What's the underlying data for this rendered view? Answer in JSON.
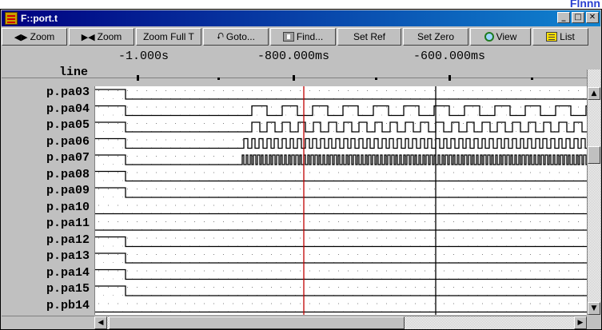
{
  "corner_text": "Flnnn",
  "window": {
    "title": "F::port.t"
  },
  "window_buttons": {
    "minimize": "_",
    "maximize": "□",
    "close": "✕"
  },
  "toolbar": [
    {
      "label": "Zoom",
      "icon": "◀▶",
      "icon_name": "zoom-out-icon"
    },
    {
      "label": "Zoom",
      "icon": "▶◀",
      "icon_name": "zoom-in-icon"
    },
    {
      "label": "Zoom Full T",
      "icon": "",
      "icon_name": ""
    },
    {
      "label": "Goto...",
      "icon": "⮏",
      "icon_name": "goto-icon"
    },
    {
      "label": "Find...",
      "icon": "find",
      "icon_name": "binoculars-icon"
    },
    {
      "label": "Set Ref",
      "icon": "",
      "icon_name": ""
    },
    {
      "label": "Set Zero",
      "icon": "",
      "icon_name": ""
    },
    {
      "label": "View",
      "icon": "view",
      "icon_name": "magnifier-icon"
    },
    {
      "label": "List",
      "icon": "list",
      "icon_name": "list-icon"
    }
  ],
  "timeline": {
    "labels": [
      "-1.000s",
      "-800.000ms",
      "-600.000ms"
    ],
    "line_header": "line"
  },
  "signals": [
    "p.pa03",
    "p.pa04",
    "p.pa05",
    "p.pa06",
    "p.pa07",
    "p.pa08",
    "p.pa09",
    "p.pa10",
    "p.pa11",
    "p.pa12",
    "p.pa13",
    "p.pa14",
    "p.pa15",
    "p.pb14"
  ],
  "colors": {
    "title_gradient_start": "#000080",
    "cursor_red": "#c00000",
    "cursor_black": "#000000",
    "corner_text": "#2a3fd0"
  }
}
